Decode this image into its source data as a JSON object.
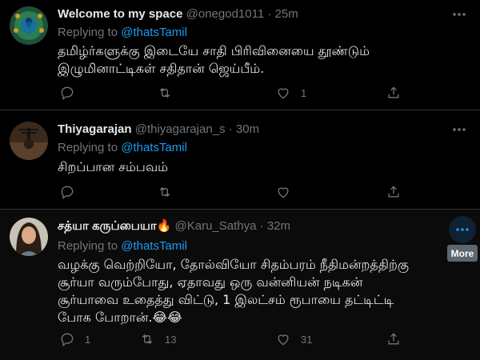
{
  "tweets": [
    {
      "display_name": "Welcome to my space",
      "handle": "@onegod1011",
      "time": "25m",
      "replying_prefix": "Replying to",
      "replying_to": "@thatsTamil",
      "text_lines": [
        "தமிழ்ர்களுக்கு இடையே சாதி பிரிவினையை தூண்டும்",
        "இழுமினாட்டிகள் சதிதான்  ஜெய்பீம்."
      ],
      "counts": {
        "reply": "",
        "retweet": "",
        "like": "1"
      }
    },
    {
      "display_name": "Thiyagarajan",
      "handle": "@thiyagarajan_s",
      "time": "30m",
      "replying_prefix": "Replying to",
      "replying_to": "@thatsTamil",
      "text_lines": [
        "சிறப்பான சம்பவம்"
      ],
      "counts": {
        "reply": "",
        "retweet": "",
        "like": ""
      }
    },
    {
      "display_name": "சத்யா கருப்பையா",
      "name_emoji": "🔥",
      "handle": "@Karu_Sathya",
      "time": "32m",
      "replying_prefix": "Replying to",
      "replying_to": "@thatsTamil",
      "text_lines": [
        "வழக்கு வெற்றியோ, தோல்வியோ சிதம்பரம் நீதிமன்றத்திற்கு",
        "சூர்யா வரும்போது, ஏதாவது ஒரு வன்னியன் நடிகன்",
        "சூர்யாவை உதைத்து விட்டு, 1 இலட்சம் ரூபாயை தட்டிட்டி",
        "போக போறான்.😂😂"
      ],
      "counts": {
        "reply": "1",
        "retweet": "13",
        "like": "31"
      }
    }
  ],
  "separator": "·",
  "tooltip": "More",
  "icons": {
    "reply": "reply-icon",
    "retweet": "retweet-icon",
    "like": "like-icon",
    "share": "share-icon",
    "more": "more-icon"
  },
  "colors": {
    "background": "#000000",
    "link": "#1d9bf0",
    "muted": "#71767b",
    "text": "#e7e9ea"
  }
}
